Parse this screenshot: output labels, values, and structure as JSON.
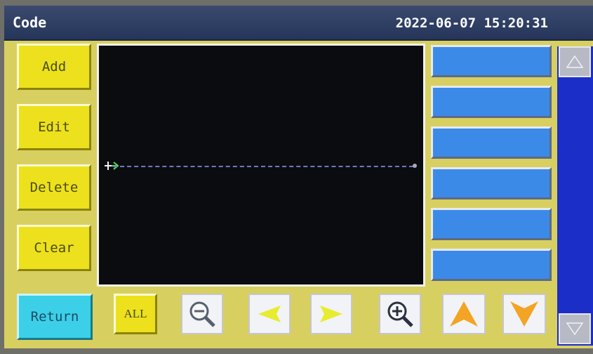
{
  "header": {
    "title": "Code",
    "datetime": "2022-06-07 15:20:31"
  },
  "sidebar": {
    "add_label": "Add",
    "edit_label": "Edit",
    "delete_label": "Delete",
    "clear_label": "Clear"
  },
  "bottom": {
    "return_label": "Return",
    "all_label": "ALL"
  },
  "code_list": {
    "slots": [
      "",
      "",
      "",
      "",
      "",
      ""
    ]
  },
  "icons": [
    "zoom-out-icon",
    "arrow-left-icon",
    "arrow-right-icon",
    "zoom-in-icon",
    "arrow-up-icon",
    "arrow-down-icon",
    "scroll-up-icon",
    "scroll-down-icon",
    "origin-marker-icon"
  ],
  "colors": {
    "panel": "#d8cf61",
    "button_yellow": "#ece11c",
    "button_cyan": "#3bd0e8",
    "slot_blue": "#3c8ae8",
    "scrollbar": "#1c2ec8",
    "arrow_orange": "#f3a424",
    "canvas": "#0b0c0f"
  }
}
